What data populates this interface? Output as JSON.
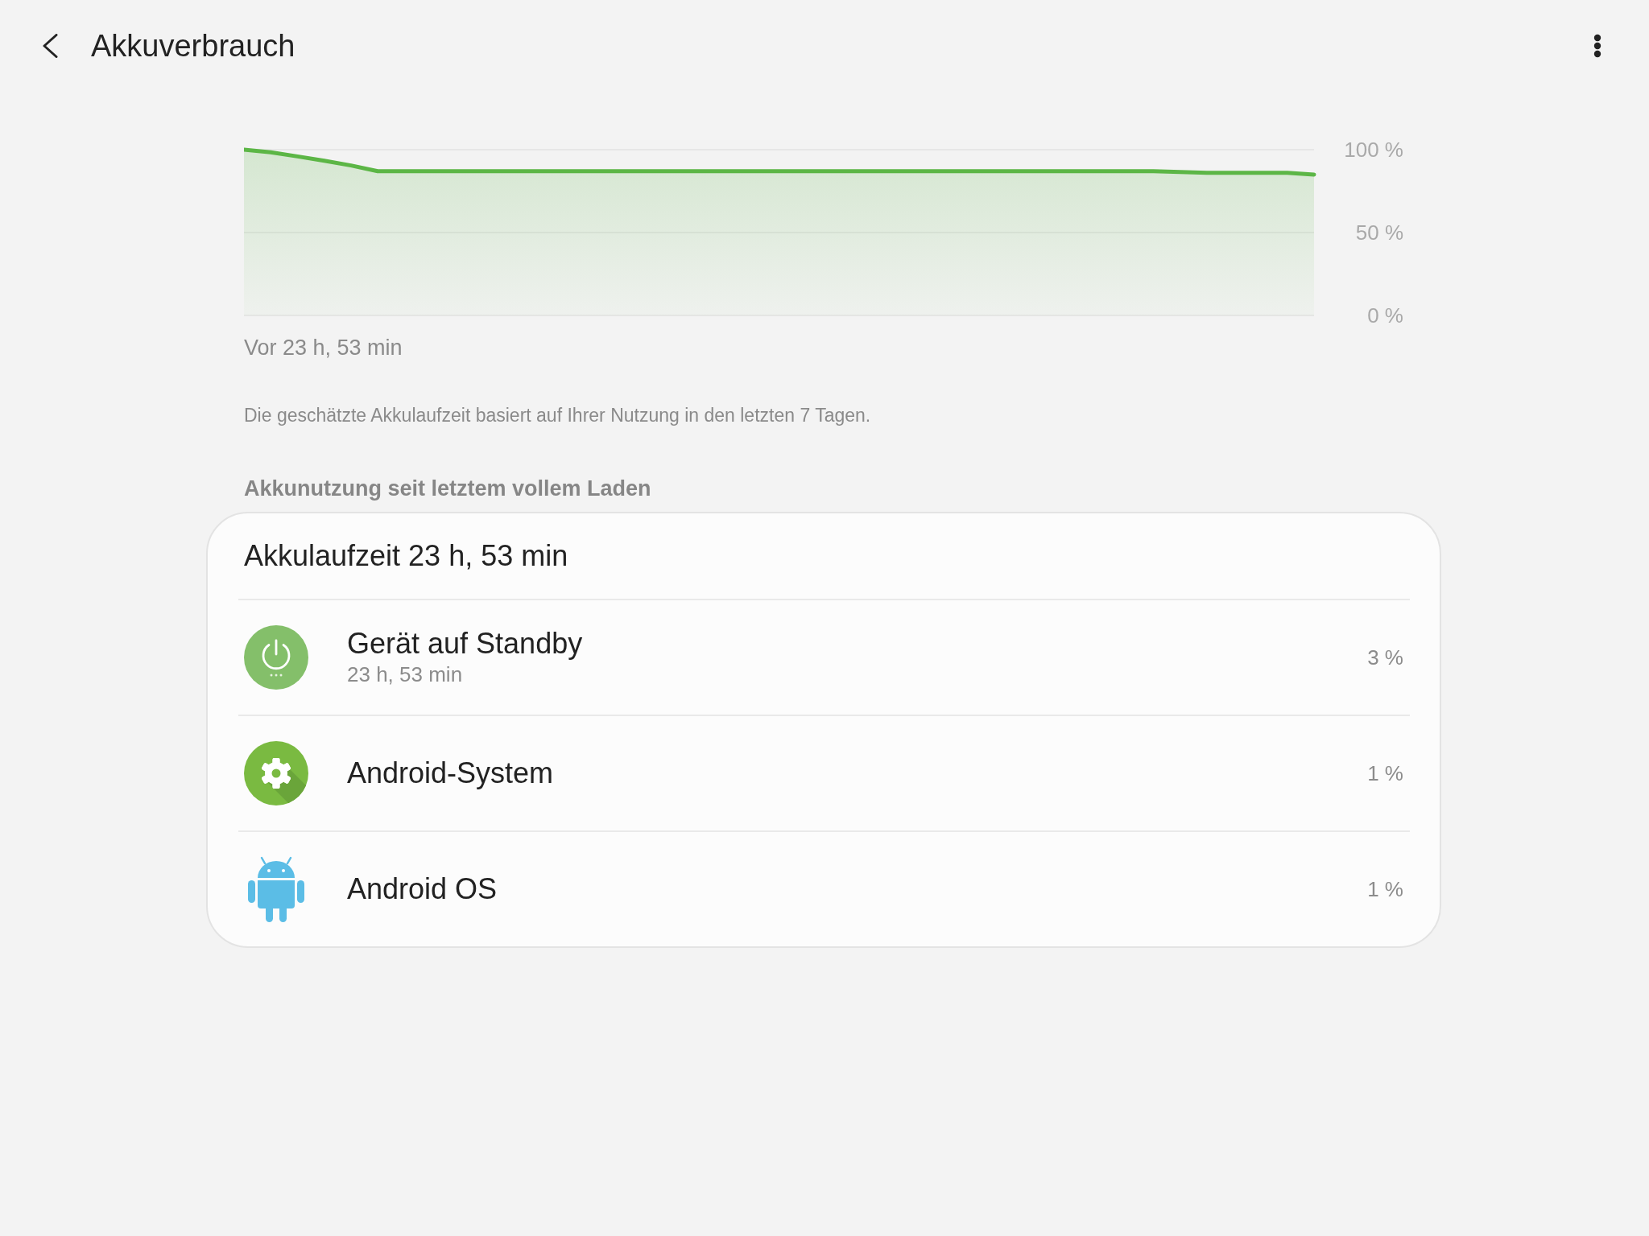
{
  "header": {
    "title": "Akkuverbrauch"
  },
  "chart": {
    "chart_data": {
      "type": "line",
      "series": [
        {
          "color": "#5cb646",
          "values": [
            100,
            98.4,
            95.9,
            93.3,
            90.5,
            87,
            87,
            87,
            87,
            87,
            87,
            87,
            87,
            87,
            87,
            87,
            87,
            87,
            87,
            87,
            87,
            87,
            87,
            87,
            87,
            87,
            87,
            87,
            87,
            87,
            87,
            87,
            87,
            87,
            87,
            86.5,
            86,
            86,
            86,
            86,
            85
          ]
        }
      ],
      "ylim": [
        0,
        100
      ],
      "yticks": [
        {
          "value": 100,
          "label": "100 %"
        },
        {
          "value": 50,
          "label": "50 %"
        },
        {
          "value": 0,
          "label": "0 %"
        }
      ],
      "annotations": [
        {
          "text": "Vor 23 h, 53 min"
        }
      ]
    }
  },
  "note": "Die geschätzte Akkulaufzeit basiert auf Ihrer Nutzung in den letzten 7 Tagen.",
  "section_title": "Akkunutzung seit letztem vollem Laden",
  "usage_card": {
    "title": "Akkulaufzeit 23 h, 53 min",
    "items": [
      {
        "name": "Gerät auf Standby",
        "detail": "23 h, 53 min",
        "share": "3 %"
      },
      {
        "name": "Android-System",
        "share": "1 %"
      },
      {
        "name": "Android OS",
        "share": "1 %"
      }
    ]
  }
}
